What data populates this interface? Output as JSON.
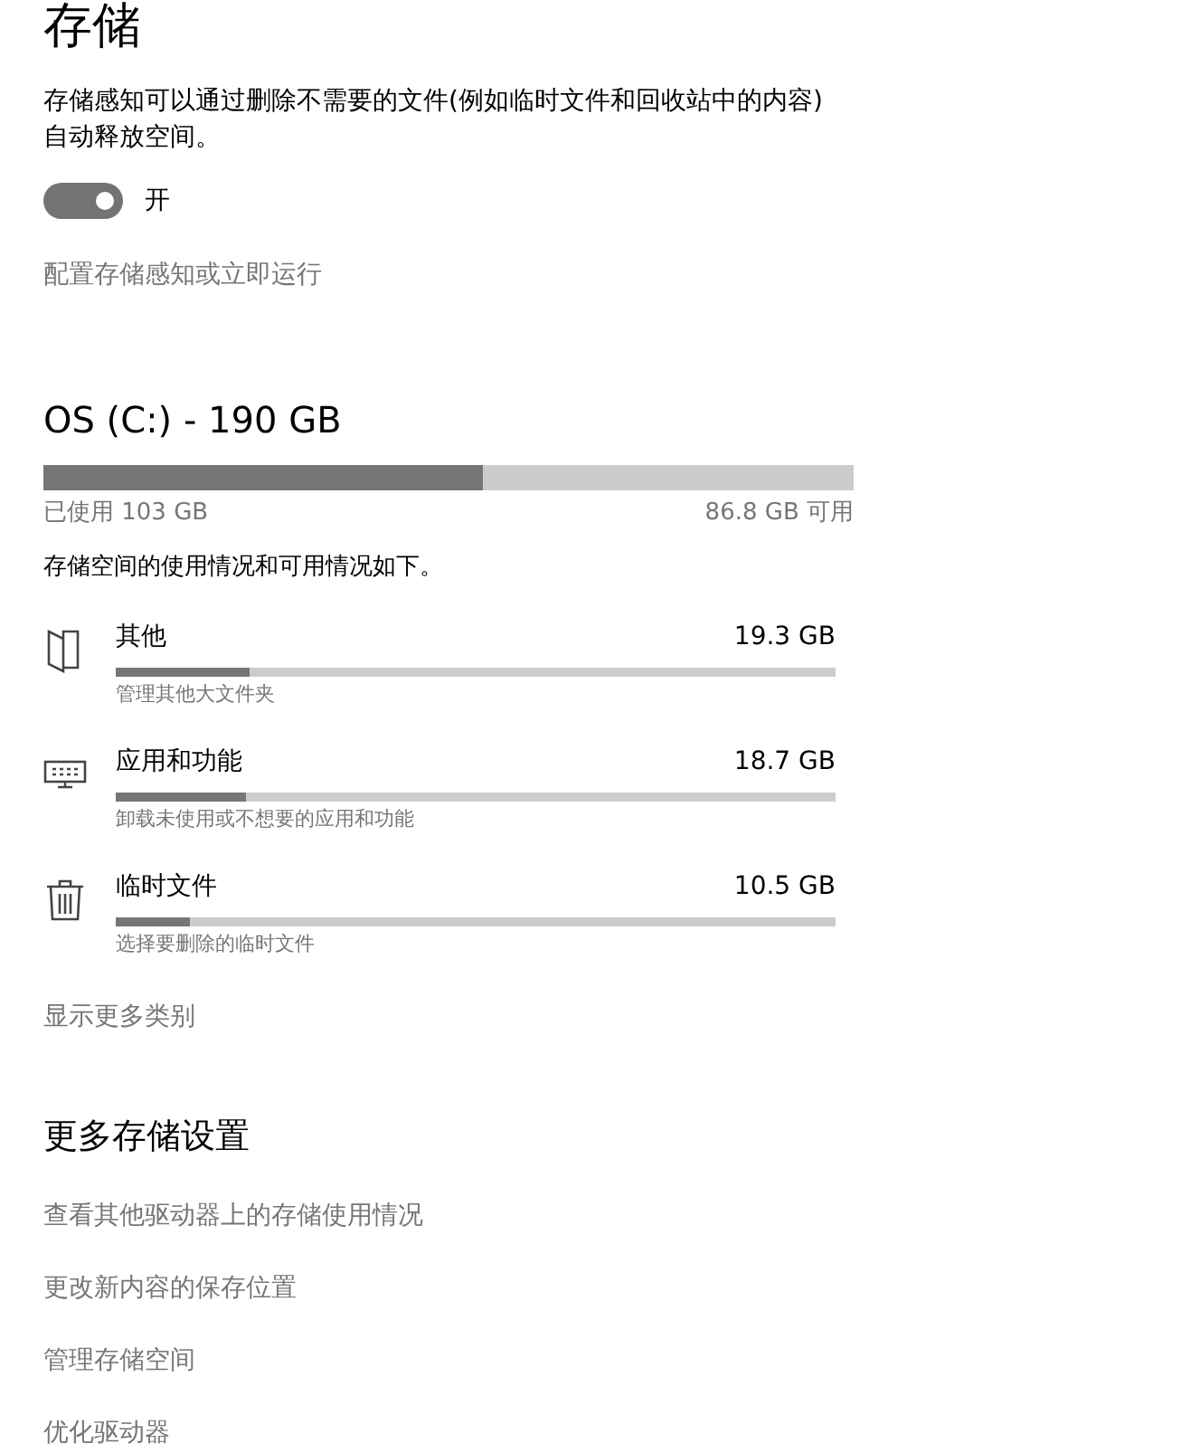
{
  "title": "存储",
  "storage_sense": {
    "description": "存储感知可以通过删除不需要的文件(例如临时文件和回收站中的内容)自动释放空间。",
    "toggle": {
      "on": true,
      "label": "开"
    },
    "link": "配置存储感知或立即运行"
  },
  "drive": {
    "name": "OS (C:) - 190 GB",
    "level": 0.542,
    "used": "已使用 103 GB",
    "free": "86.8 GB 可用",
    "description": "存储空间的使用情况和可用情况如下。"
  },
  "categories": [
    {
      "kind": "other",
      "name": "其他",
      "size": "19.3 GB",
      "level": 0.186,
      "hint": "管理其他大文件夹"
    },
    {
      "kind": "apps",
      "name": "应用和功能",
      "size": "18.7 GB",
      "level": 0.18,
      "hint": "卸载未使用或不想要的应用和功能"
    },
    {
      "kind": "temp",
      "name": "临时文件",
      "size": "10.5 GB",
      "level": 0.103,
      "hint": "选择要删除的临时文件"
    }
  ],
  "show_more": "显示更多类别",
  "more_settings": {
    "heading": "更多存储设置",
    "links": [
      "查看其他驱动器上的存储使用情况",
      "更改新内容的保存位置",
      "管理存储空间",
      "优化驱动器"
    ]
  }
}
